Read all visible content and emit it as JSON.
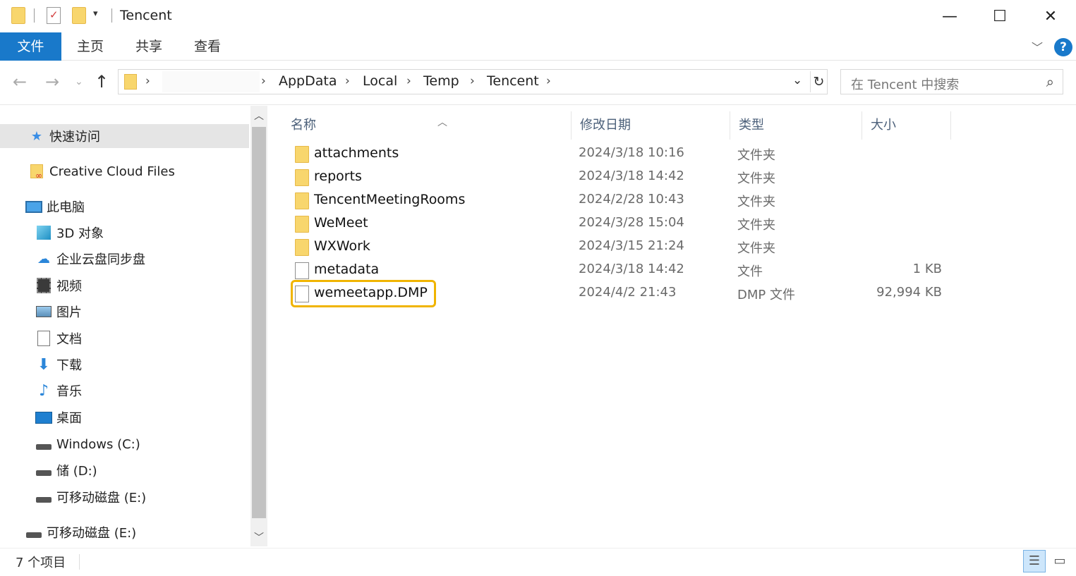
{
  "window": {
    "title": "Tencent",
    "minimize_glyph": "—",
    "maximize_glyph": "☐",
    "close_glyph": "✕"
  },
  "ribbon": {
    "tabs": [
      "文件",
      "主页",
      "共享",
      "查看"
    ],
    "help_glyph": "?"
  },
  "address": {
    "breadcrumbs": [
      "AppData",
      "Local",
      "Temp",
      "Tencent"
    ],
    "search_placeholder": "在 Tencent 中搜索"
  },
  "nav_pane": {
    "items": [
      {
        "label": "快速访问",
        "icon": "star-icon",
        "selected": true
      },
      {
        "label": "Creative Cloud Files",
        "icon": "creative-cloud-folder-icon"
      },
      {
        "label": "此电脑",
        "icon": "computer-icon"
      },
      {
        "label": "3D 对象",
        "icon": "cube-icon"
      },
      {
        "label": "企业云盘同步盘",
        "icon": "cloud-icon"
      },
      {
        "label": "视频",
        "icon": "video-icon"
      },
      {
        "label": "图片",
        "icon": "picture-icon"
      },
      {
        "label": "文档",
        "icon": "document-icon"
      },
      {
        "label": "下载",
        "icon": "download-icon"
      },
      {
        "label": "音乐",
        "icon": "music-icon"
      },
      {
        "label": "桌面",
        "icon": "desktop-icon"
      },
      {
        "label": "Windows (C:)",
        "icon": "drive-icon"
      },
      {
        "label": "储 (D:)",
        "icon": "drive-icon"
      },
      {
        "label": "可移动磁盘 (E:)",
        "icon": "drive-icon"
      },
      {
        "label": "可移动磁盘 (E:)",
        "icon": "drive-icon"
      }
    ]
  },
  "file_list": {
    "columns": [
      "名称",
      "修改日期",
      "类型",
      "大小"
    ],
    "rows": [
      {
        "name": "attachments",
        "date": "2024/3/18 10:16",
        "type": "文件夹",
        "size": "",
        "kind": "folder"
      },
      {
        "name": "reports",
        "date": "2024/3/18 14:42",
        "type": "文件夹",
        "size": "",
        "kind": "folder"
      },
      {
        "name": "TencentMeetingRooms",
        "date": "2024/2/28 10:43",
        "type": "文件夹",
        "size": "",
        "kind": "folder"
      },
      {
        "name": "WeMeet",
        "date": "2024/3/28 15:04",
        "type": "文件夹",
        "size": "",
        "kind": "folder"
      },
      {
        "name": "WXWork",
        "date": "2024/3/15 21:24",
        "type": "文件夹",
        "size": "",
        "kind": "folder"
      },
      {
        "name": "metadata",
        "date": "2024/3/18 14:42",
        "type": "文件",
        "size": "1 KB",
        "kind": "file"
      },
      {
        "name": "wemeetapp.DMP",
        "date": "2024/4/2 21:43",
        "type": "DMP 文件",
        "size": "92,994 KB",
        "kind": "file"
      }
    ]
  },
  "status": {
    "item_count": "7 个项目"
  },
  "colors": {
    "accent": "#1979ca",
    "highlight": "#f0b400",
    "folder": "#f8d66d"
  }
}
